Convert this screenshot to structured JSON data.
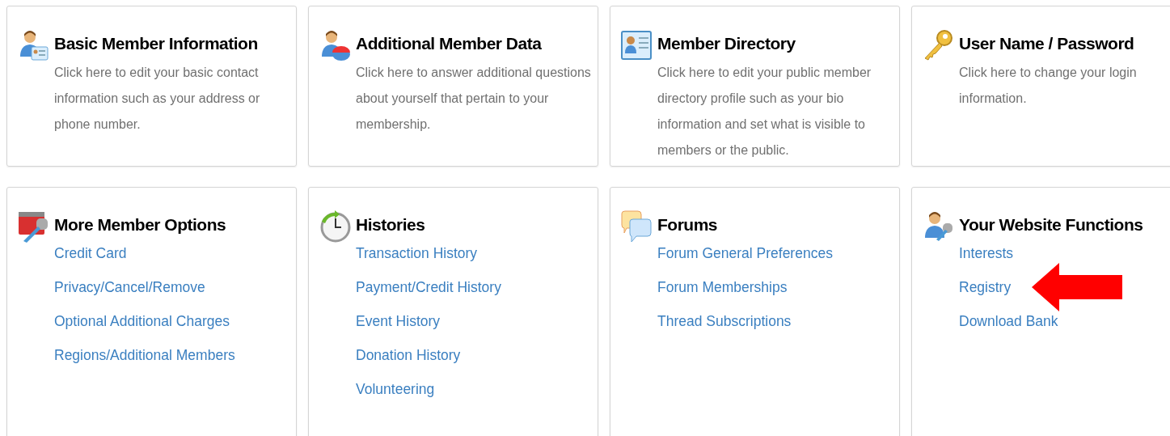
{
  "panels": [
    {
      "kind": "person-card",
      "title": "Basic Member Information",
      "description": "Click here to edit your basic contact information such as your address or phone number."
    },
    {
      "kind": "person-pie",
      "title": "Additional Member Data",
      "description": "Click here to answer additional questions about yourself that pertain to your membership."
    },
    {
      "kind": "directory-card",
      "title": "Member Directory",
      "description": "Click here to edit your public member directory profile such as your bio information and set what is visible to members or the public."
    },
    {
      "kind": "key",
      "title": "User Name / Password",
      "description": "Click here to change your login information."
    },
    {
      "kind": "card-wrench",
      "title": "More Member Options",
      "links": [
        {
          "label": "Credit Card",
          "highlighted": false
        },
        {
          "label": "Privacy/Cancel/Remove",
          "highlighted": false
        },
        {
          "label": "Optional Additional Charges",
          "highlighted": false
        },
        {
          "label": "Regions/Additional Members",
          "highlighted": false
        }
      ]
    },
    {
      "kind": "clock",
      "title": "Histories",
      "links": [
        {
          "label": "Transaction History",
          "highlighted": false
        },
        {
          "label": "Payment/Credit History",
          "highlighted": false
        },
        {
          "label": "Event History",
          "highlighted": false
        },
        {
          "label": "Donation History",
          "highlighted": false
        },
        {
          "label": "Volunteering",
          "highlighted": false
        }
      ]
    },
    {
      "kind": "chat",
      "title": "Forums",
      "links": [
        {
          "label": "Forum General Preferences",
          "highlighted": false
        },
        {
          "label": "Forum Memberships",
          "highlighted": false
        },
        {
          "label": "Thread Subscriptions",
          "highlighted": false
        }
      ]
    },
    {
      "kind": "person-wrench",
      "title": "Your Website Functions",
      "links": [
        {
          "label": "Interests",
          "highlighted": false
        },
        {
          "label": "Registry",
          "highlighted": true
        },
        {
          "label": "Download Bank",
          "highlighted": false
        }
      ]
    }
  ]
}
